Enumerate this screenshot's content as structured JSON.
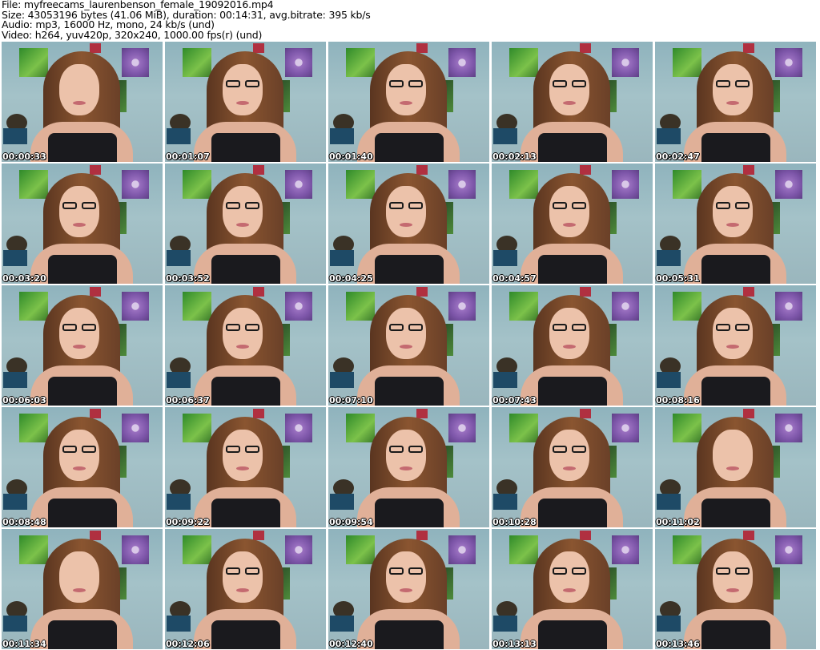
{
  "header": {
    "file": "File: myfreecams_laurenbenson_female_19092016.mp4",
    "size": "Size: 43053196 bytes (41.06 MiB), duration: 00:14:31, avg.bitrate: 395 kb/s",
    "audio": "Audio: mp3, 16000 Hz, mono, 24 kb/s (und)",
    "video": "Video: h264, yuv420p, 320x240, 1000.00 fps(r) (und)"
  },
  "frames": [
    {
      "time": "00:00:33",
      "glasses": false
    },
    {
      "time": "00:01:07",
      "glasses": true
    },
    {
      "time": "00:01:40",
      "glasses": true
    },
    {
      "time": "00:02:13",
      "glasses": true
    },
    {
      "time": "00:02:47",
      "glasses": true
    },
    {
      "time": "00:03:20",
      "glasses": true
    },
    {
      "time": "00:03:52",
      "glasses": true
    },
    {
      "time": "00:04:25",
      "glasses": true
    },
    {
      "time": "00:04:57",
      "glasses": true
    },
    {
      "time": "00:05:31",
      "glasses": true
    },
    {
      "time": "00:06:03",
      "glasses": true
    },
    {
      "time": "00:06:37",
      "glasses": true
    },
    {
      "time": "00:07:10",
      "glasses": true
    },
    {
      "time": "00:07:43",
      "glasses": true
    },
    {
      "time": "00:08:16",
      "glasses": true
    },
    {
      "time": "00:08:48",
      "glasses": true
    },
    {
      "time": "00:09:22",
      "glasses": true
    },
    {
      "time": "00:09:54",
      "glasses": true
    },
    {
      "time": "00:10:28",
      "glasses": true
    },
    {
      "time": "00:11:02",
      "glasses": false
    },
    {
      "time": "00:11:34",
      "glasses": false
    },
    {
      "time": "00:12:06",
      "glasses": true
    },
    {
      "time": "00:12:40",
      "glasses": true
    },
    {
      "time": "00:13:13",
      "glasses": true
    },
    {
      "time": "00:13:46",
      "glasses": true
    }
  ]
}
